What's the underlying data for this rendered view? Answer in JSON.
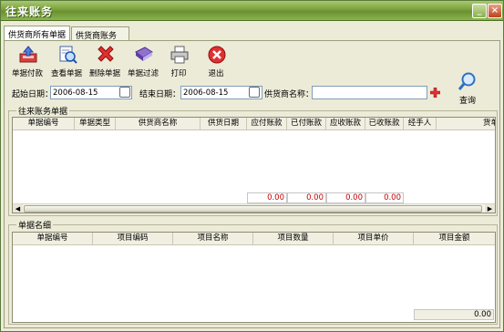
{
  "window": {
    "title": "往来账务"
  },
  "tabs": [
    {
      "label": "供货商所有单据"
    },
    {
      "label": "供货商账务"
    }
  ],
  "toolbar": {
    "pay": "单据付款",
    "view": "查看单据",
    "delete": "删除单据",
    "filter": "单据过滤",
    "print": "打印",
    "exit": "退出"
  },
  "filters": {
    "start_label": "起始日期：",
    "start_value": "2006-08-15",
    "end_label": "结束日期：",
    "end_value": "2006-08-15",
    "supplier_label": "供货商名称：",
    "supplier_value": "",
    "search_label": "查询"
  },
  "ledger": {
    "title": "往来账务单据",
    "columns": [
      "单据编号",
      "单据类型",
      "供货商名称",
      "供货日期",
      "应付账款",
      "已付账款",
      "应收账款",
      "已收账款",
      "经手人",
      "货单"
    ],
    "totals": [
      "0.00",
      "0.00",
      "0.00",
      "0.00"
    ]
  },
  "details": {
    "title": "单据名细",
    "columns": [
      "单据编号",
      "项目编码",
      "项目名称",
      "项目数量",
      "项目单价",
      "项目金额"
    ],
    "total": "0.00"
  },
  "colors": {
    "titlebar": "#7aa13a",
    "total_text": "#c00000"
  }
}
